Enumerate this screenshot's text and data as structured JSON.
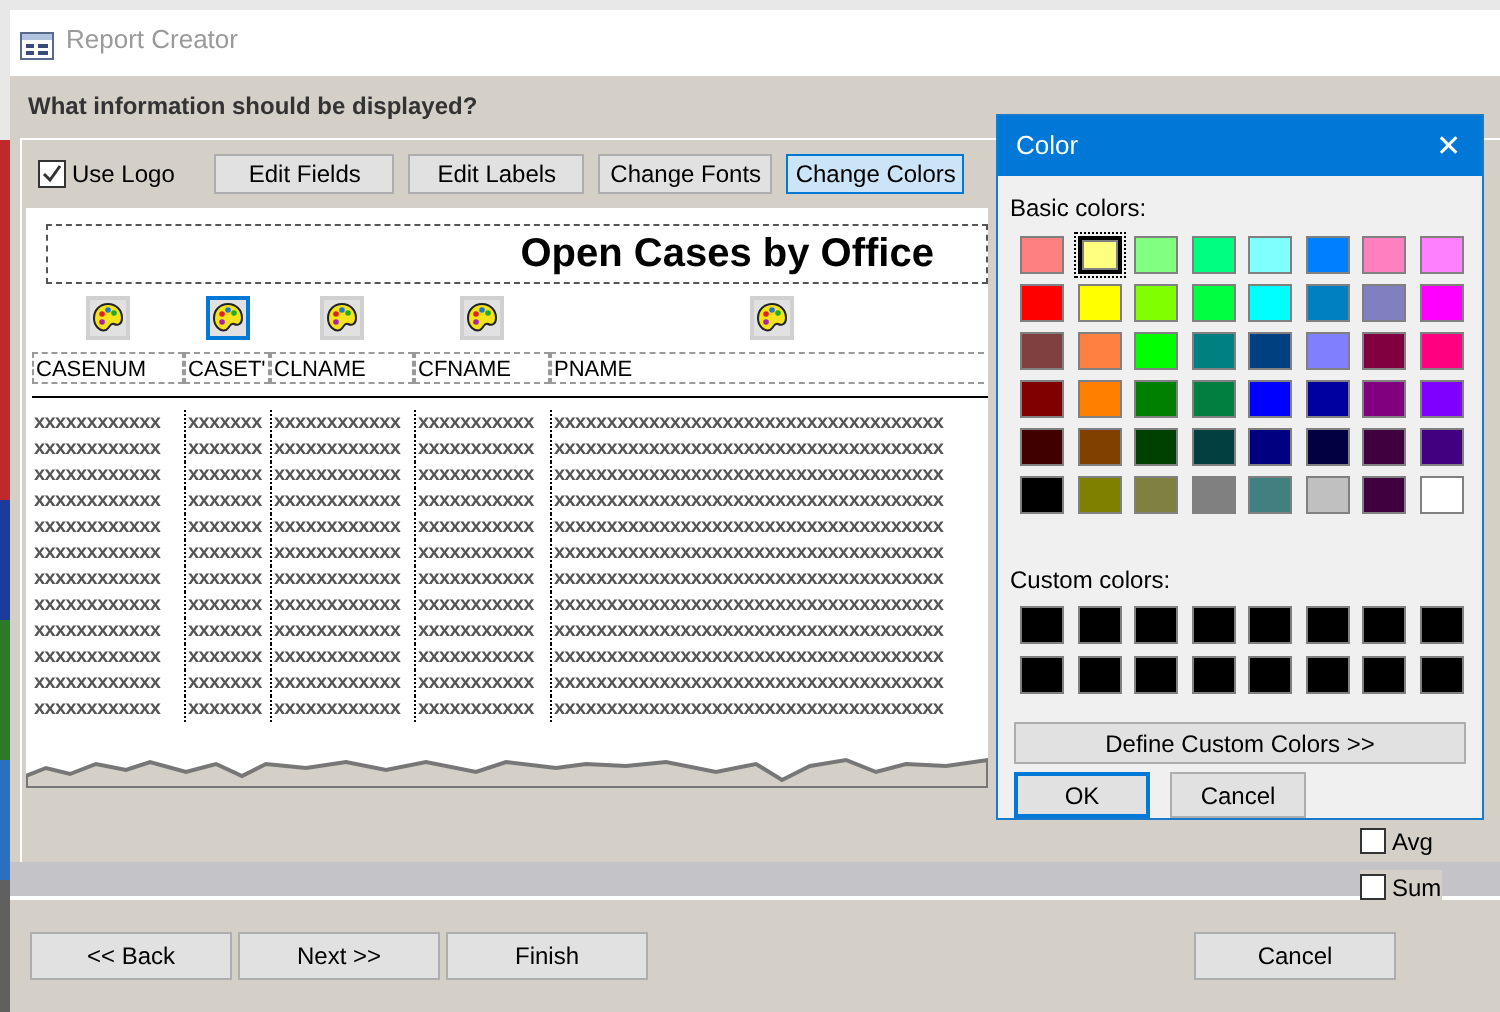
{
  "window": {
    "title": "Report Creator"
  },
  "prompt": "What information should be displayed?",
  "toolbar": {
    "use_logo": {
      "label": "Use Logo",
      "checked": true
    },
    "buttons": [
      {
        "label": "Edit Fields",
        "selected": false
      },
      {
        "label": "Edit Labels",
        "selected": false
      },
      {
        "label": "Change Fonts",
        "selected": false
      },
      {
        "label": "Change Colors",
        "selected": true
      }
    ]
  },
  "report": {
    "title": "Open Cases by Office",
    "columns": [
      {
        "header": "CASENUM",
        "selected": false
      },
      {
        "header": "CASET'",
        "selected": true
      },
      {
        "header": "CLNAME",
        "selected": false
      },
      {
        "header": "CFNAME",
        "selected": false
      },
      {
        "header": "PNAME",
        "selected": false
      }
    ],
    "rows": [
      [
        "xxxxxxxxxxxx",
        "xxxxxxx",
        "xxxxxxxxxxxx",
        "xxxxxxxxxxx",
        "xxxxxxxxxxxxxxxxxxxxxxxxxxxxxxxxxxxxx"
      ],
      [
        "xxxxxxxxxxxx",
        "xxxxxxx",
        "xxxxxxxxxxxx",
        "xxxxxxxxxxx",
        "xxxxxxxxxxxxxxxxxxxxxxxxxxxxxxxxxxxxx"
      ],
      [
        "xxxxxxxxxxxx",
        "xxxxxxx",
        "xxxxxxxxxxxx",
        "xxxxxxxxxxx",
        "xxxxxxxxxxxxxxxxxxxxxxxxxxxxxxxxxxxxx"
      ],
      [
        "xxxxxxxxxxxx",
        "xxxxxxx",
        "xxxxxxxxxxxx",
        "xxxxxxxxxxx",
        "xxxxxxxxxxxxxxxxxxxxxxxxxxxxxxxxxxxxx"
      ],
      [
        "xxxxxxxxxxxx",
        "xxxxxxx",
        "xxxxxxxxxxxx",
        "xxxxxxxxxxx",
        "xxxxxxxxxxxxxxxxxxxxxxxxxxxxxxxxxxxxx"
      ],
      [
        "xxxxxxxxxxxx",
        "xxxxxxx",
        "xxxxxxxxxxxx",
        "xxxxxxxxxxx",
        "xxxxxxxxxxxxxxxxxxxxxxxxxxxxxxxxxxxxx"
      ],
      [
        "xxxxxxxxxxxx",
        "xxxxxxx",
        "xxxxxxxxxxxx",
        "xxxxxxxxxxx",
        "xxxxxxxxxxxxxxxxxxxxxxxxxxxxxxxxxxxxx"
      ],
      [
        "xxxxxxxxxxxx",
        "xxxxxxx",
        "xxxxxxxxxxxx",
        "xxxxxxxxxxx",
        "xxxxxxxxxxxxxxxxxxxxxxxxxxxxxxxxxxxxx"
      ],
      [
        "xxxxxxxxxxxx",
        "xxxxxxx",
        "xxxxxxxxxxxx",
        "xxxxxxxxxxx",
        "xxxxxxxxxxxxxxxxxxxxxxxxxxxxxxxxxxxxx"
      ],
      [
        "xxxxxxxxxxxx",
        "xxxxxxx",
        "xxxxxxxxxxxx",
        "xxxxxxxxxxx",
        "xxxxxxxxxxxxxxxxxxxxxxxxxxxxxxxxxxxxx"
      ],
      [
        "xxxxxxxxxxxx",
        "xxxxxxx",
        "xxxxxxxxxxxx",
        "xxxxxxxxxxx",
        "xxxxxxxxxxxxxxxxxxxxxxxxxxxxxxxxxxxxx"
      ],
      [
        "xxxxxxxxxxxx",
        "xxxxxxx",
        "xxxxxxxxxxxx",
        "xxxxxxxxxxx",
        "xxxxxxxxxxxxxxxxxxxxxxxxxxxxxxxxxxxxx"
      ]
    ]
  },
  "summary_options": [
    {
      "label": "Avg",
      "checked": false
    },
    {
      "label": "Sum",
      "checked": false
    }
  ],
  "nav_buttons": [
    "<< Back",
    "Next >>",
    "Finish"
  ],
  "cancel_button": "Cancel",
  "color_dialog": {
    "title": "Color",
    "close": "✕",
    "basic_label": "Basic colors:",
    "basic_colors": [
      {
        "color": "#ff8080",
        "selected": false
      },
      {
        "color": "#ffff80",
        "selected": true
      },
      {
        "color": "#80ff80",
        "selected": false
      },
      {
        "color": "#00ff80",
        "selected": false
      },
      {
        "color": "#80ffff",
        "selected": false
      },
      {
        "color": "#0080ff",
        "selected": false
      },
      {
        "color": "#ff80c0",
        "selected": false
      },
      {
        "color": "#ff80ff",
        "selected": false
      },
      {
        "color": "#ff0000",
        "selected": false
      },
      {
        "color": "#ffff00",
        "selected": false
      },
      {
        "color": "#80ff00",
        "selected": false
      },
      {
        "color": "#00ff40",
        "selected": false
      },
      {
        "color": "#00ffff",
        "selected": false
      },
      {
        "color": "#0080c0",
        "selected": false
      },
      {
        "color": "#8080c0",
        "selected": false
      },
      {
        "color": "#ff00ff",
        "selected": false
      },
      {
        "color": "#804040",
        "selected": false
      },
      {
        "color": "#ff8040",
        "selected": false
      },
      {
        "color": "#00ff00",
        "selected": false
      },
      {
        "color": "#008080",
        "selected": false
      },
      {
        "color": "#004080",
        "selected": false
      },
      {
        "color": "#8080ff",
        "selected": false
      },
      {
        "color": "#800040",
        "selected": false
      },
      {
        "color": "#ff0080",
        "selected": false
      },
      {
        "color": "#800000",
        "selected": false
      },
      {
        "color": "#ff8000",
        "selected": false
      },
      {
        "color": "#008000",
        "selected": false
      },
      {
        "color": "#008040",
        "selected": false
      },
      {
        "color": "#0000ff",
        "selected": false
      },
      {
        "color": "#0000a0",
        "selected": false
      },
      {
        "color": "#800080",
        "selected": false
      },
      {
        "color": "#8000ff",
        "selected": false
      },
      {
        "color": "#400000",
        "selected": false
      },
      {
        "color": "#804000",
        "selected": false
      },
      {
        "color": "#004000",
        "selected": false
      },
      {
        "color": "#004040",
        "selected": false
      },
      {
        "color": "#000080",
        "selected": false
      },
      {
        "color": "#000040",
        "selected": false
      },
      {
        "color": "#400040",
        "selected": false
      },
      {
        "color": "#400080",
        "selected": false
      },
      {
        "color": "#000000",
        "selected": false
      },
      {
        "color": "#808000",
        "selected": false
      },
      {
        "color": "#808040",
        "selected": false
      },
      {
        "color": "#808080",
        "selected": false
      },
      {
        "color": "#408080",
        "selected": false
      },
      {
        "color": "#c0c0c0",
        "selected": false
      },
      {
        "color": "#400040",
        "selected": false
      },
      {
        "color": "#ffffff",
        "selected": false
      }
    ],
    "custom_label": "Custom colors:",
    "custom_colors": [
      {
        "color": "#000000"
      },
      {
        "color": "#000000"
      },
      {
        "color": "#000000"
      },
      {
        "color": "#000000"
      },
      {
        "color": "#000000"
      },
      {
        "color": "#000000"
      },
      {
        "color": "#000000"
      },
      {
        "color": "#000000"
      },
      {
        "color": "#000000"
      },
      {
        "color": "#000000"
      },
      {
        "color": "#000000"
      },
      {
        "color": "#000000"
      },
      {
        "color": "#000000"
      },
      {
        "color": "#000000"
      },
      {
        "color": "#000000"
      },
      {
        "color": "#000000"
      }
    ],
    "define_button": "Define Custom Colors >>",
    "ok_button": "OK",
    "cancel_button": "Cancel"
  }
}
